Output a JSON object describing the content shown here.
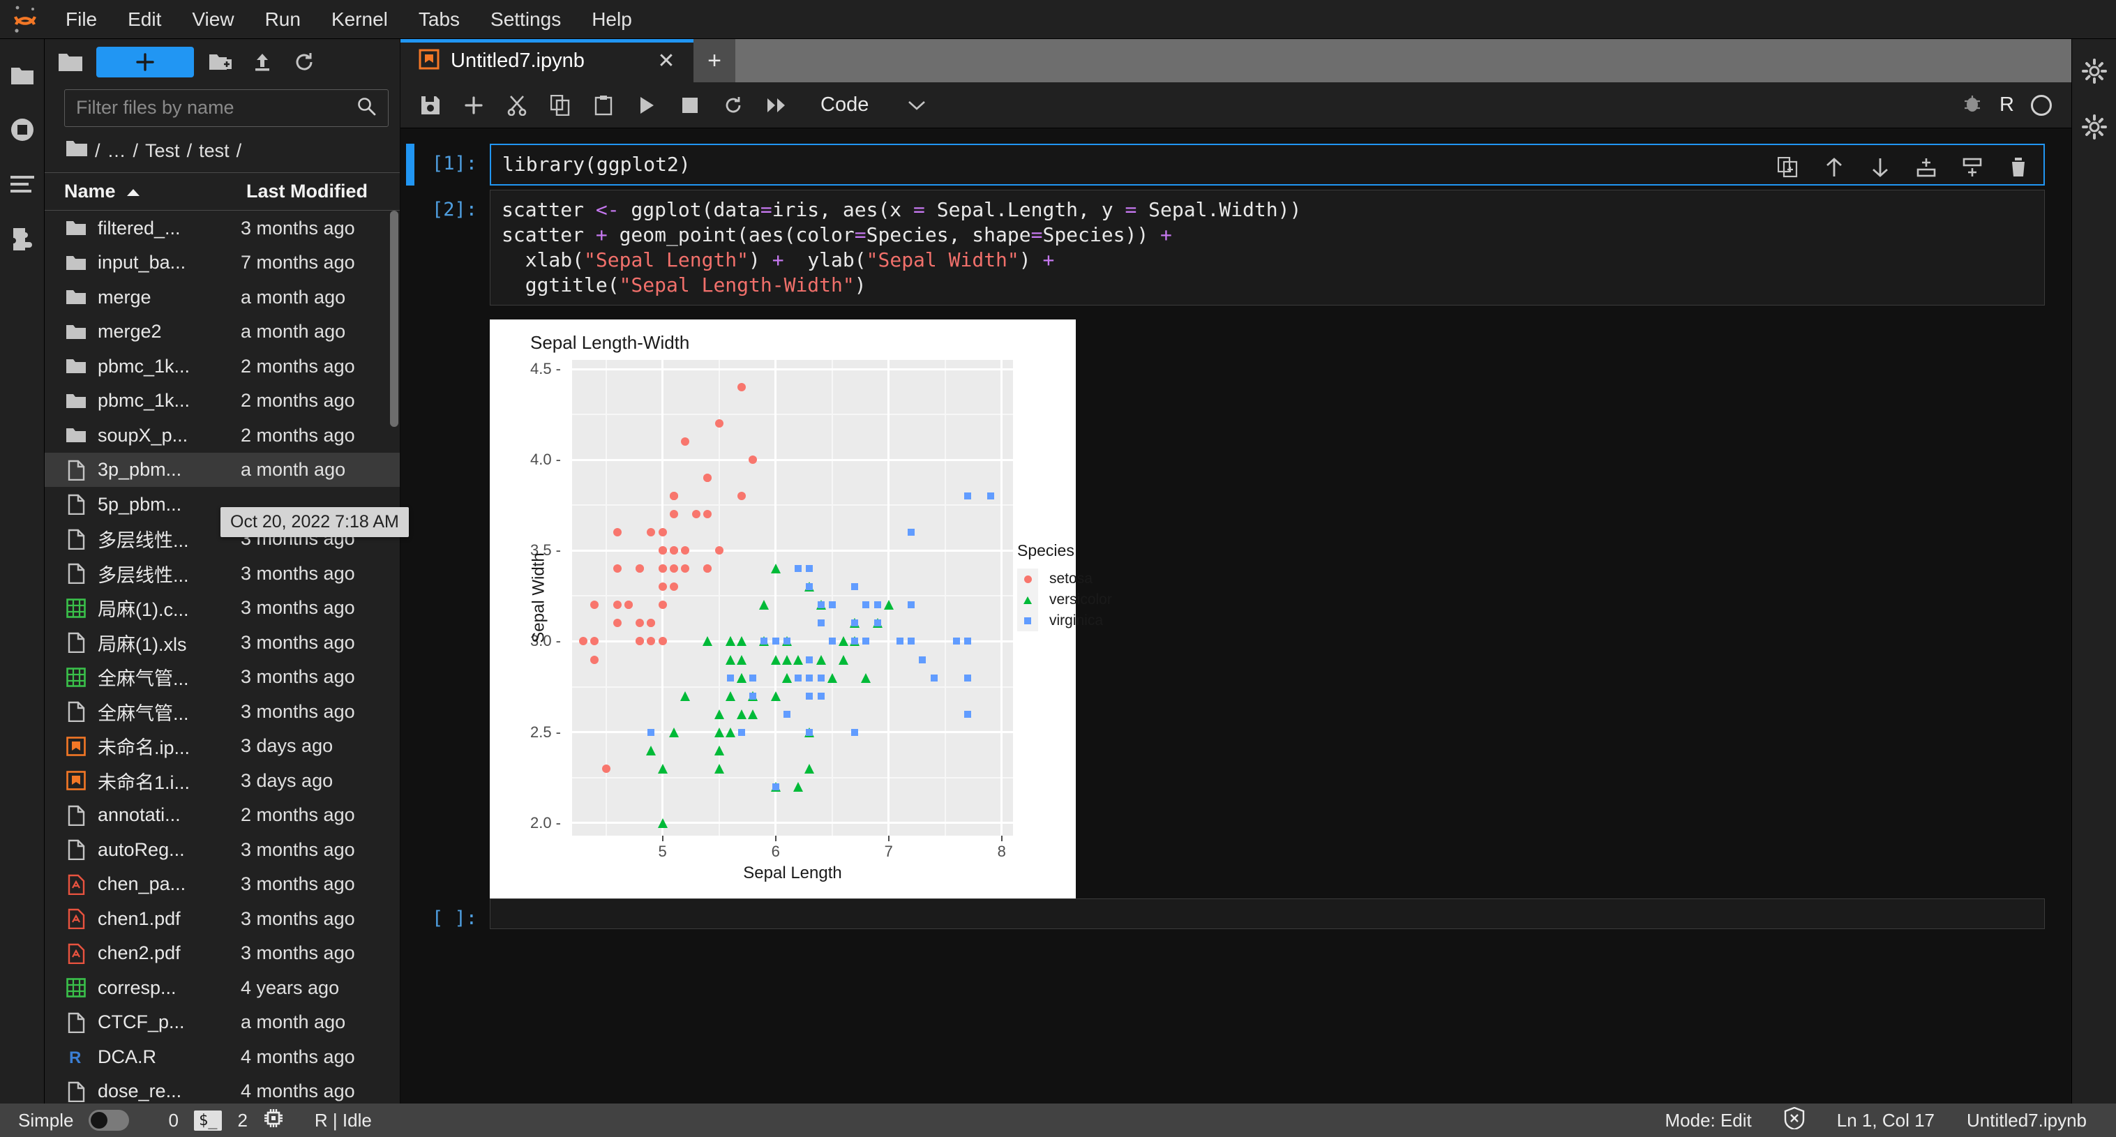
{
  "menubar": {
    "logo_name": "jupyter-logo",
    "items": [
      "File",
      "Edit",
      "View",
      "Run",
      "Kernel",
      "Tabs",
      "Settings",
      "Help"
    ]
  },
  "activitybar": {
    "items": [
      {
        "name": "sidebar-item-file-browser",
        "icon": "folder-icon"
      },
      {
        "name": "sidebar-item-running",
        "icon": "stop-square-icon"
      },
      {
        "name": "sidebar-item-toc",
        "icon": "list-icon"
      },
      {
        "name": "sidebar-item-extensions",
        "icon": "puzzle-icon"
      }
    ]
  },
  "filebrowser": {
    "new_launcher_label": "+",
    "toolbar": [
      {
        "name": "new-folder-button",
        "icon": "new-folder-icon"
      },
      {
        "name": "upload-button",
        "icon": "upload-icon"
      },
      {
        "name": "refresh-button",
        "icon": "refresh-icon"
      }
    ],
    "filter": {
      "value": "",
      "placeholder": "Filter files by name"
    },
    "breadcrumb": [
      "/",
      "…",
      "/",
      "Test",
      "/",
      "test",
      "/"
    ],
    "columns": {
      "name": "Name",
      "modified": "Last Modified"
    },
    "sort_direction": "asc",
    "tooltip": "Oct 20, 2022 7:18 AM",
    "files": [
      {
        "name": "filtered_...",
        "modified": "3 months ago",
        "type": "folder"
      },
      {
        "name": "input_ba...",
        "modified": "7 months ago",
        "type": "folder"
      },
      {
        "name": "merge",
        "modified": "a month ago",
        "type": "folder"
      },
      {
        "name": "merge2",
        "modified": "a month ago",
        "type": "folder"
      },
      {
        "name": "pbmc_1k...",
        "modified": "2 months ago",
        "type": "folder"
      },
      {
        "name": "pbmc_1k...",
        "modified": "2 months ago",
        "type": "folder"
      },
      {
        "name": "soupX_p...",
        "modified": "2 months ago",
        "type": "folder"
      },
      {
        "name": "3p_pbm...",
        "modified": "a month ago",
        "type": "file",
        "selected": true
      },
      {
        "name": "5p_pbm...",
        "modified": "",
        "type": "file"
      },
      {
        "name": "多层线性...",
        "modified": "3 months ago",
        "type": "file"
      },
      {
        "name": "多层线性...",
        "modified": "3 months ago",
        "type": "file"
      },
      {
        "name": "局麻(1).c...",
        "modified": "3 months ago",
        "type": "spreadsheet"
      },
      {
        "name": "局麻(1).xls",
        "modified": "3 months ago",
        "type": "file"
      },
      {
        "name": "全麻气管...",
        "modified": "3 months ago",
        "type": "spreadsheet"
      },
      {
        "name": "全麻气管...",
        "modified": "3 months ago",
        "type": "file"
      },
      {
        "name": "未命名.ip...",
        "modified": "3 days ago",
        "type": "notebook"
      },
      {
        "name": "未命名1.i...",
        "modified": "3 days ago",
        "type": "notebook"
      },
      {
        "name": "annotati...",
        "modified": "2 months ago",
        "type": "file"
      },
      {
        "name": "autoReg...",
        "modified": "3 months ago",
        "type": "file"
      },
      {
        "name": "chen_pa...",
        "modified": "3 months ago",
        "type": "pdf"
      },
      {
        "name": "chen1.pdf",
        "modified": "3 months ago",
        "type": "pdf"
      },
      {
        "name": "chen2.pdf",
        "modified": "3 months ago",
        "type": "pdf"
      },
      {
        "name": "corresp...",
        "modified": "4 years ago",
        "type": "spreadsheet"
      },
      {
        "name": "CTCF_p...",
        "modified": "a month ago",
        "type": "file"
      },
      {
        "name": "DCA.R",
        "modified": "4 months ago",
        "type": "r-file"
      },
      {
        "name": "dose_re...",
        "modified": "4 months ago",
        "type": "file"
      }
    ]
  },
  "tabbar": {
    "tabs": [
      {
        "title": "Untitled7.ipynb",
        "icon": "notebook-icon",
        "active": true
      }
    ],
    "add_label": "+"
  },
  "notebook_toolbar": {
    "buttons": [
      {
        "name": "save-button",
        "icon": "save-icon"
      },
      {
        "name": "insert-cell-button",
        "icon": "plus-icon"
      },
      {
        "name": "cut-cell-button",
        "icon": "scissors-icon"
      },
      {
        "name": "copy-cell-button",
        "icon": "copy-icon"
      },
      {
        "name": "paste-cell-button",
        "icon": "paste-icon"
      },
      {
        "name": "run-cell-button",
        "icon": "play-icon"
      },
      {
        "name": "interrupt-kernel-button",
        "icon": "stop-icon"
      },
      {
        "name": "restart-kernel-button",
        "icon": "restart-icon"
      },
      {
        "name": "restart-run-all-button",
        "icon": "fast-forward-icon"
      }
    ],
    "cell_type": "Code",
    "kernel_name": "R"
  },
  "cells": [
    {
      "prompt": "[1]:",
      "active": true,
      "lines": [
        [
          {
            "t": "library(ggplot2)",
            "c": "plain"
          }
        ]
      ]
    },
    {
      "prompt": "[2]:",
      "active": false,
      "lines": [
        [
          {
            "t": "scatter ",
            "c": "plain"
          },
          {
            "t": "<-",
            "c": "op"
          },
          {
            "t": " ggplot(data",
            "c": "plain"
          },
          {
            "t": "=",
            "c": "op"
          },
          {
            "t": "iris, aes(x ",
            "c": "plain"
          },
          {
            "t": "=",
            "c": "op"
          },
          {
            "t": " Sepal.Length, y ",
            "c": "plain"
          },
          {
            "t": "=",
            "c": "op"
          },
          {
            "t": " Sepal.Width))",
            "c": "plain"
          }
        ],
        [
          {
            "t": "scatter ",
            "c": "plain"
          },
          {
            "t": "+",
            "c": "op"
          },
          {
            "t": " geom_point(aes(color",
            "c": "plain"
          },
          {
            "t": "=",
            "c": "op"
          },
          {
            "t": "Species, shape",
            "c": "plain"
          },
          {
            "t": "=",
            "c": "op"
          },
          {
            "t": "Species)) ",
            "c": "plain"
          },
          {
            "t": "+",
            "c": "op"
          }
        ],
        [
          {
            "t": "  xlab(",
            "c": "plain"
          },
          {
            "t": "\"Sepal Length\"",
            "c": "str"
          },
          {
            "t": ") ",
            "c": "plain"
          },
          {
            "t": "+",
            "c": "op"
          },
          {
            "t": "  ylab(",
            "c": "plain"
          },
          {
            "t": "\"Sepal Width\"",
            "c": "str"
          },
          {
            "t": ") ",
            "c": "plain"
          },
          {
            "t": "+",
            "c": "op"
          }
        ],
        [
          {
            "t": "  ggtitle(",
            "c": "plain"
          },
          {
            "t": "\"Sepal Length-Width\"",
            "c": "str"
          },
          {
            "t": ")",
            "c": "plain"
          }
        ]
      ]
    },
    {
      "prompt": "[ ]:",
      "active": false,
      "lines": [
        [
          {
            "t": "",
            "c": "plain"
          }
        ]
      ]
    }
  ],
  "cell_toolbar": [
    {
      "name": "duplicate-cell-icon",
      "icon": "duplicate-icon"
    },
    {
      "name": "move-cell-up-icon",
      "icon": "arrow-up-icon"
    },
    {
      "name": "move-cell-down-icon",
      "icon": "arrow-down-icon"
    },
    {
      "name": "insert-cell-above-icon",
      "icon": "insert-above-icon"
    },
    {
      "name": "insert-cell-below-icon",
      "icon": "insert-below-icon"
    },
    {
      "name": "delete-cell-icon",
      "icon": "trash-icon"
    }
  ],
  "rightbar": {
    "items": [
      {
        "name": "property-inspector-button",
        "icon": "gear-icon"
      },
      {
        "name": "debugger-button",
        "icon": "gear-icon"
      }
    ]
  },
  "statusbar": {
    "simple_label": "Simple",
    "simple_on": false,
    "kernel_count": "0",
    "terminal_badge": "$_",
    "terminal_count": "2",
    "kernel_status": "R | Idle",
    "mode": "Mode: Edit",
    "cursor": "Ln 1, Col 17",
    "filename": "Untitled7.ipynb"
  },
  "chart_data": {
    "type": "scatter",
    "title": "Sepal Length-Width",
    "xlabel": "Sepal Length",
    "ylabel": "Sepal Width",
    "xlim": [
      4.2,
      8.1
    ],
    "ylim": [
      1.93,
      4.55
    ],
    "xticks": [
      5,
      6,
      7,
      8
    ],
    "yticks": [
      2.0,
      2.5,
      3.0,
      3.5,
      4.0,
      4.5
    ],
    "grid": true,
    "legend_title": "Species",
    "legend_position": "right",
    "series": [
      {
        "name": "setosa",
        "color": "#F8766D",
        "shape": "circle",
        "points": [
          [
            5.1,
            3.5
          ],
          [
            4.9,
            3.0
          ],
          [
            4.7,
            3.2
          ],
          [
            4.6,
            3.1
          ],
          [
            5.0,
            3.6
          ],
          [
            5.4,
            3.9
          ],
          [
            4.6,
            3.4
          ],
          [
            5.0,
            3.4
          ],
          [
            4.4,
            2.9
          ],
          [
            4.9,
            3.1
          ],
          [
            5.4,
            3.7
          ],
          [
            4.8,
            3.4
          ],
          [
            4.8,
            3.0
          ],
          [
            4.3,
            3.0
          ],
          [
            5.8,
            4.0
          ],
          [
            5.7,
            4.4
          ],
          [
            5.4,
            3.9
          ],
          [
            5.1,
            3.5
          ],
          [
            5.7,
            3.8
          ],
          [
            5.1,
            3.8
          ],
          [
            5.4,
            3.4
          ],
          [
            5.1,
            3.7
          ],
          [
            4.6,
            3.6
          ],
          [
            5.1,
            3.3
          ],
          [
            4.8,
            3.4
          ],
          [
            5.0,
            3.0
          ],
          [
            5.0,
            3.4
          ],
          [
            5.2,
            3.5
          ],
          [
            5.2,
            3.4
          ],
          [
            4.7,
            3.2
          ],
          [
            4.8,
            3.1
          ],
          [
            5.4,
            3.4
          ],
          [
            5.2,
            4.1
          ],
          [
            5.5,
            4.2
          ],
          [
            4.9,
            3.1
          ],
          [
            5.0,
            3.2
          ],
          [
            5.5,
            3.5
          ],
          [
            4.9,
            3.6
          ],
          [
            4.4,
            3.0
          ],
          [
            5.1,
            3.4
          ],
          [
            5.0,
            3.5
          ],
          [
            4.5,
            2.3
          ],
          [
            4.4,
            3.2
          ],
          [
            5.0,
            3.5
          ],
          [
            5.1,
            3.8
          ],
          [
            4.8,
            3.0
          ],
          [
            5.1,
            3.8
          ],
          [
            4.6,
            3.2
          ],
          [
            5.3,
            3.7
          ],
          [
            5.0,
            3.3
          ]
        ]
      },
      {
        "name": "versicolor",
        "color": "#00BA38",
        "shape": "triangle",
        "points": [
          [
            7.0,
            3.2
          ],
          [
            6.4,
            3.2
          ],
          [
            6.9,
            3.1
          ],
          [
            5.5,
            2.3
          ],
          [
            6.5,
            2.8
          ],
          [
            5.7,
            2.8
          ],
          [
            6.3,
            3.3
          ],
          [
            4.9,
            2.4
          ],
          [
            6.6,
            2.9
          ],
          [
            5.2,
            2.7
          ],
          [
            5.0,
            2.0
          ],
          [
            5.9,
            3.0
          ],
          [
            6.0,
            2.2
          ],
          [
            6.1,
            2.9
          ],
          [
            5.6,
            2.9
          ],
          [
            6.7,
            3.1
          ],
          [
            5.6,
            3.0
          ],
          [
            5.8,
            2.7
          ],
          [
            6.2,
            2.2
          ],
          [
            5.6,
            2.5
          ],
          [
            5.9,
            3.2
          ],
          [
            6.1,
            2.8
          ],
          [
            6.3,
            2.5
          ],
          [
            6.1,
            2.8
          ],
          [
            6.4,
            2.9
          ],
          [
            6.6,
            3.0
          ],
          [
            6.8,
            2.8
          ],
          [
            6.7,
            3.0
          ],
          [
            6.0,
            2.9
          ],
          [
            5.7,
            2.6
          ],
          [
            5.5,
            2.4
          ],
          [
            5.5,
            2.4
          ],
          [
            5.8,
            2.7
          ],
          [
            6.0,
            2.7
          ],
          [
            5.4,
            3.0
          ],
          [
            6.0,
            3.4
          ],
          [
            6.7,
            3.1
          ],
          [
            6.3,
            2.3
          ],
          [
            5.6,
            3.0
          ],
          [
            5.5,
            2.5
          ],
          [
            5.5,
            2.6
          ],
          [
            6.1,
            3.0
          ],
          [
            5.8,
            2.6
          ],
          [
            5.0,
            2.3
          ],
          [
            5.6,
            2.7
          ],
          [
            5.7,
            3.0
          ],
          [
            5.7,
            2.9
          ],
          [
            6.2,
            2.9
          ],
          [
            5.1,
            2.5
          ],
          [
            5.7,
            2.8
          ]
        ]
      },
      {
        "name": "virginica",
        "color": "#619CFF",
        "shape": "square",
        "points": [
          [
            6.3,
            3.3
          ],
          [
            5.8,
            2.7
          ],
          [
            7.1,
            3.0
          ],
          [
            6.3,
            2.9
          ],
          [
            6.5,
            3.0
          ],
          [
            7.6,
            3.0
          ],
          [
            4.9,
            2.5
          ],
          [
            7.3,
            2.9
          ],
          [
            6.7,
            2.5
          ],
          [
            7.2,
            3.6
          ],
          [
            6.5,
            3.2
          ],
          [
            6.4,
            2.7
          ],
          [
            6.8,
            3.0
          ],
          [
            5.7,
            2.5
          ],
          [
            5.8,
            2.8
          ],
          [
            6.4,
            3.2
          ],
          [
            6.5,
            3.0
          ],
          [
            7.7,
            3.8
          ],
          [
            7.7,
            2.6
          ],
          [
            6.0,
            2.2
          ],
          [
            6.9,
            3.2
          ],
          [
            5.6,
            2.8
          ],
          [
            7.7,
            2.8
          ],
          [
            6.3,
            2.7
          ],
          [
            6.7,
            3.3
          ],
          [
            7.2,
            3.2
          ],
          [
            6.2,
            2.8
          ],
          [
            6.1,
            3.0
          ],
          [
            6.4,
            2.8
          ],
          [
            7.2,
            3.0
          ],
          [
            7.4,
            2.8
          ],
          [
            7.9,
            3.8
          ],
          [
            6.4,
            2.8
          ],
          [
            6.3,
            2.8
          ],
          [
            6.1,
            2.6
          ],
          [
            7.7,
            3.0
          ],
          [
            6.3,
            3.4
          ],
          [
            6.4,
            3.1
          ],
          [
            6.0,
            3.0
          ],
          [
            6.9,
            3.1
          ],
          [
            6.7,
            3.1
          ],
          [
            6.9,
            3.1
          ],
          [
            5.8,
            2.7
          ],
          [
            6.8,
            3.2
          ],
          [
            6.7,
            3.3
          ],
          [
            6.7,
            3.0
          ],
          [
            6.3,
            2.5
          ],
          [
            6.5,
            3.0
          ],
          [
            6.2,
            3.4
          ],
          [
            5.9,
            3.0
          ]
        ]
      }
    ]
  }
}
